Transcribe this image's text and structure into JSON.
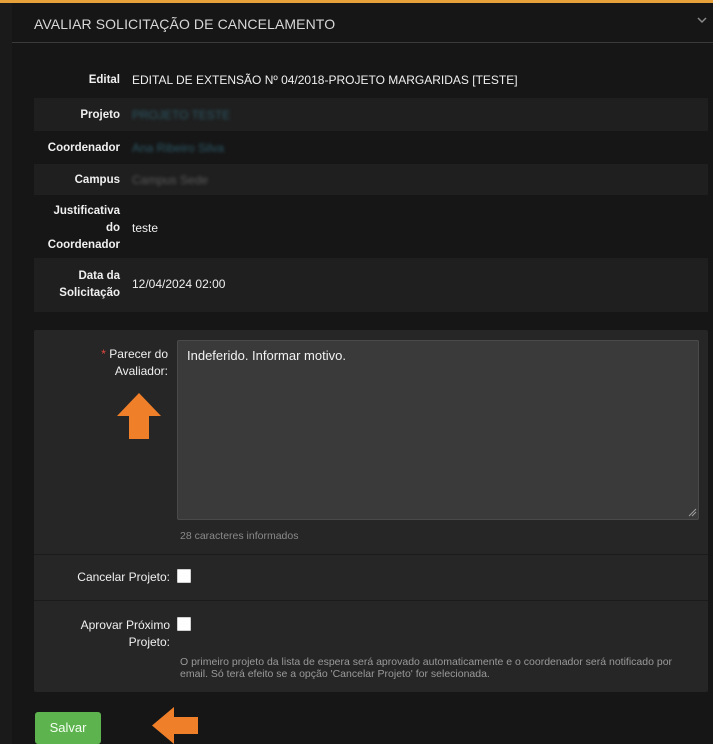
{
  "panel": {
    "title": "AVALIAR SOLICITAÇÃO DE CANCELAMENTO"
  },
  "info": {
    "edital_label": "Edital",
    "edital_value": "EDITAL DE EXTENSÃO Nº 04/2018-PROJETO MARGARIDAS [TESTE]",
    "projeto_label": "Projeto",
    "projeto_value": "PROJETO TESTE",
    "coordenador_label": "Coordenador",
    "coordenador_value": "Ana Ribeiro Silva",
    "campus_label": "Campus",
    "campus_value": "Campus Sede",
    "justificativa_label_1": "Justificativa",
    "justificativa_label_2": "do",
    "justificativa_label_3": "Coordenador",
    "justificativa_value": "teste",
    "data_label_1": "Data da",
    "data_label_2": "Solicitação",
    "data_value": "12/04/2024 02:00"
  },
  "form": {
    "parecer_label_1": "Parecer do",
    "parecer_label_2": "Avaliador:",
    "required_mark": "*",
    "parecer_value": "Indeferido. Informar motivo.",
    "char_count": "28 caracteres informados",
    "cancelar_label": "Cancelar Projeto:",
    "aprovar_label_1": "Aprovar Próximo",
    "aprovar_label_2": "Projeto:",
    "help_text": "O primeiro projeto da lista de espera será aprovado automaticamente e o coordenador será notificado por email. Só terá efeito se a opção 'Cancelar Projeto' for selecionada.",
    "save_label": "Salvar"
  },
  "colors": {
    "accent_top": "#e7a13b",
    "arrow": "#f07f2a",
    "save": "#5db34e"
  }
}
